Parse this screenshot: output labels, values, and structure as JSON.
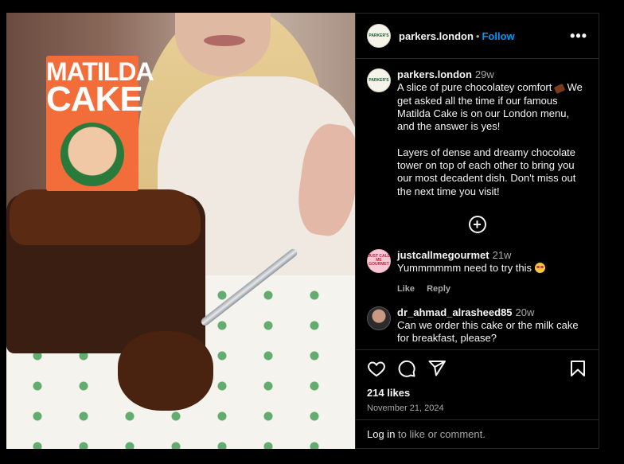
{
  "post": {
    "image": {
      "alt": "",
      "sign_line1": "MATILDA",
      "sign_line2": "CAKE"
    },
    "header": {
      "avatar_text": "PARKER'S",
      "username": "parkers.london",
      "separator": "•",
      "follow_label": "Follow",
      "more_icon": "more-horizontal-icon"
    },
    "caption": {
      "username": "parkers.london",
      "time": "29w",
      "text_part1": "A slice of pure chocolatey comfort ",
      "text_part2": " We get asked all the time if our famous Matilda Cake is on our London menu, and the answer is yes!\n\nLayers of dense and dreamy chocolate tower on top of each other to bring you our most decadent dish. Don't miss out the next time you visit!"
    },
    "load_more_icon": "plus-circle-icon",
    "comments": [
      {
        "avatar_text": "JUST CALL ME GOURMET",
        "username": "justcallmegourmet",
        "time": "21w",
        "text": "Yummmmmm need to try this ",
        "like_label": "Like",
        "reply_label": "Reply"
      },
      {
        "username": "dr_ahmad_alrasheed85",
        "time": "20w",
        "text": "Can we order this cake or the milk cake for breakfast, please?"
      }
    ],
    "actions": {
      "like_icon": "heart-icon",
      "comment_icon": "comment-icon",
      "share_icon": "send-icon",
      "save_icon": "bookmark-icon"
    },
    "likes": "214 likes",
    "date": "November 21, 2024",
    "login": {
      "link": "Log in",
      "rest": " to like or comment."
    },
    "colors": {
      "background": "#000000",
      "accent": "#0095f6",
      "muted": "#a8a8a8",
      "border": "#262626"
    }
  }
}
